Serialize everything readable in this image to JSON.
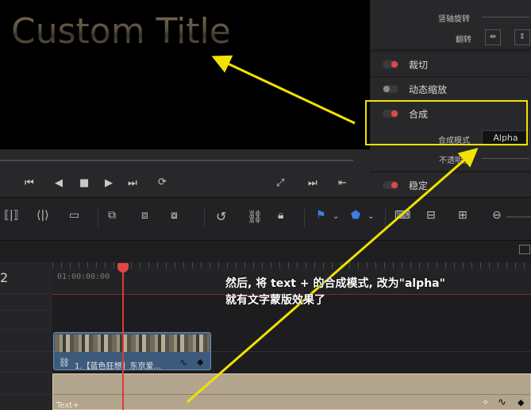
{
  "viewer": {
    "title_text": "Custom Title"
  },
  "transport": {
    "icons": [
      "skip-start-icon",
      "prev-frame-icon",
      "stop-icon",
      "play-icon",
      "skip-end-icon",
      "loop-icon",
      "fit-icon",
      "next-edit-icon",
      "last-frame-icon"
    ]
  },
  "inspector": {
    "rows": {
      "vertical_rotate": "竖轴旋转",
      "flip": "翻转",
      "crop": "裁切",
      "dynamic_zoom": "动态缩放",
      "composite": "合成",
      "composite_mode_label": "合成模式",
      "composite_mode_value": "Alpha",
      "opacity_label": "不透明度",
      "stabilize": "稳定"
    },
    "colors": {
      "toggle_on": "#e24646",
      "toggle_off": "#7a7a7a",
      "highlight": "#f2e200"
    }
  },
  "timeline": {
    "track_number": "2",
    "timecode": "01:00:00:00",
    "video_clip_label": "1.【蓝色狂想】东京爱...",
    "text_clip_label": "Text+"
  },
  "annotation": {
    "line1": "然后, 将 text + 的合成模式, 改为\"alpha\"",
    "line2": "就有文字蒙版效果了",
    "color": "#f2e200"
  }
}
